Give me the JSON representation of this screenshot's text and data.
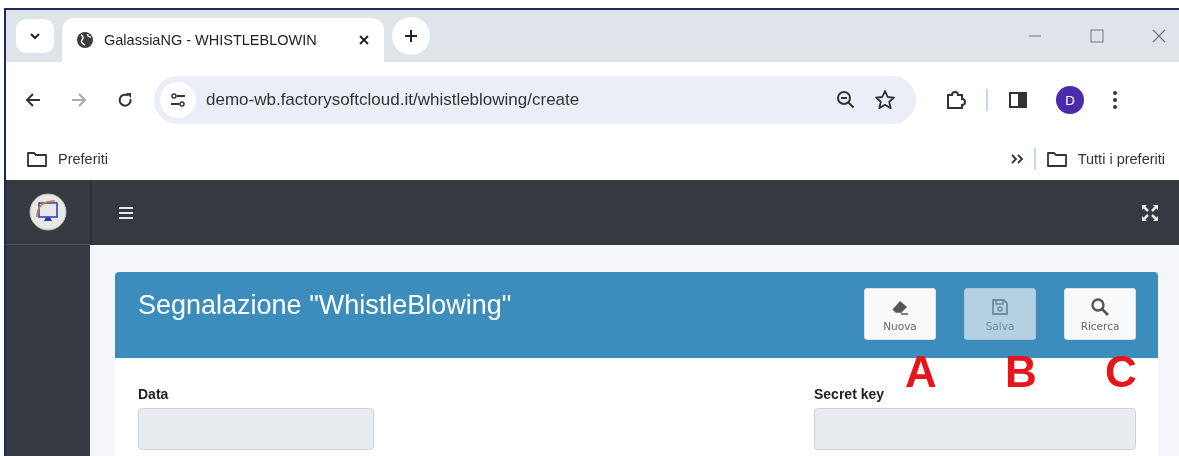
{
  "browser": {
    "tab_title": "GalassiaNG - WHISTLEBLOWIN",
    "url": "demo-wb.factorysoftcloud.it/whistleblowing/create",
    "profile_initial": "D",
    "bookmarks": [
      {
        "label": "Preferiti"
      }
    ],
    "all_bookmarks": "Tutti i preferiti"
  },
  "card": {
    "title": "Segnalazione \"WhistleBlowing\"",
    "buttons": [
      {
        "kind": "eraser",
        "label": "Nuova",
        "disabled": false
      },
      {
        "kind": "save",
        "label": "Salva",
        "disabled": true
      },
      {
        "kind": "search",
        "label": "Ricerca",
        "disabled": false
      }
    ],
    "fields": [
      {
        "label": "Data"
      },
      {
        "label": "Secret key"
      }
    ]
  },
  "annotations": [
    "A",
    "B",
    "C"
  ]
}
